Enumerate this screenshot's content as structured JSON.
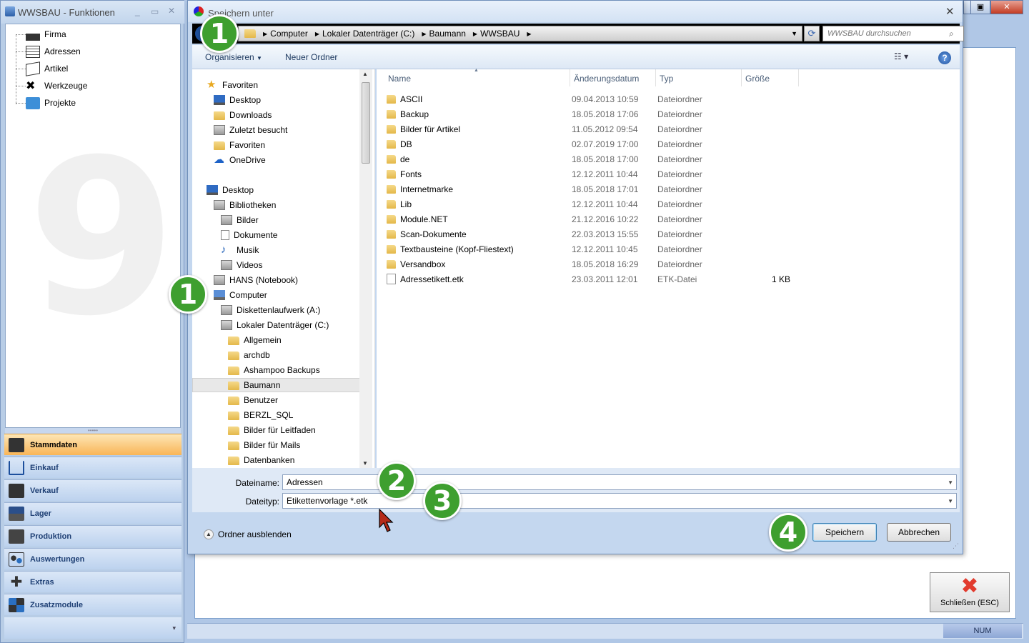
{
  "left_window": {
    "title": "WWSBAU - Funktionen",
    "tree": [
      "Firma",
      "Adressen",
      "Artikel",
      "Werkzeuge",
      "Projekte"
    ],
    "nav": [
      {
        "label": "Stammdaten",
        "active": true
      },
      {
        "label": "Einkauf"
      },
      {
        "label": "Verkauf"
      },
      {
        "label": "Lager"
      },
      {
        "label": "Produktion"
      },
      {
        "label": "Auswertungen"
      },
      {
        "label": "Extras"
      },
      {
        "label": "Zusatzmodule"
      }
    ]
  },
  "dialog": {
    "title": "Speichern unter",
    "breadcrumb": [
      "Computer",
      "Lokaler Datenträger (C:)",
      "Baumann",
      "WWSBAU"
    ],
    "search_placeholder": "WWSBAU durchsuchen",
    "toolbar": {
      "organize": "Organisieren",
      "new_folder": "Neuer Ordner"
    },
    "nav_tree": [
      {
        "label": "Favoriten",
        "level": 0,
        "icon": "star"
      },
      {
        "label": "Desktop",
        "level": 1,
        "icon": "desktop"
      },
      {
        "label": "Downloads",
        "level": 1,
        "icon": "folder"
      },
      {
        "label": "Zuletzt besucht",
        "level": 1,
        "icon": "recent"
      },
      {
        "label": "Favoriten",
        "level": 1,
        "icon": "folder"
      },
      {
        "label": "OneDrive",
        "level": 1,
        "icon": "cloud"
      },
      {
        "label": "Desktop",
        "level": 0,
        "icon": "desktop"
      },
      {
        "label": "Bibliotheken",
        "level": 1,
        "icon": "library"
      },
      {
        "label": "Bilder",
        "level": 2,
        "icon": "pictures"
      },
      {
        "label": "Dokumente",
        "level": 2,
        "icon": "document"
      },
      {
        "label": "Musik",
        "level": 2,
        "icon": "music"
      },
      {
        "label": "Videos",
        "level": 2,
        "icon": "video"
      },
      {
        "label": "HANS (Notebook)",
        "level": 1,
        "icon": "user"
      },
      {
        "label": "Computer",
        "level": 1,
        "icon": "computer"
      },
      {
        "label": "Diskettenlaufwerk (A:)",
        "level": 2,
        "icon": "floppy"
      },
      {
        "label": "Lokaler Datenträger (C:)",
        "level": 2,
        "icon": "drive"
      },
      {
        "label": "Allgemein",
        "level": 3,
        "icon": "folder"
      },
      {
        "label": "archdb",
        "level": 3,
        "icon": "folder"
      },
      {
        "label": "Ashampoo Backups",
        "level": 3,
        "icon": "folder"
      },
      {
        "label": "Baumann",
        "level": 3,
        "icon": "folder",
        "selected": true
      },
      {
        "label": "Benutzer",
        "level": 3,
        "icon": "folder"
      },
      {
        "label": "BERZL_SQL",
        "level": 3,
        "icon": "folder"
      },
      {
        "label": "Bilder für Leitfaden",
        "level": 3,
        "icon": "folder"
      },
      {
        "label": "Bilder für Mails",
        "level": 3,
        "icon": "folder"
      },
      {
        "label": "Datenbanken",
        "level": 3,
        "icon": "folder"
      }
    ],
    "columns": {
      "name": "Name",
      "date": "Änderungsdatum",
      "type": "Typ",
      "size": "Größe"
    },
    "files": [
      {
        "name": "ASCII",
        "date": "09.04.2013 10:59",
        "type": "Dateiordner",
        "size": "",
        "icon": "folder"
      },
      {
        "name": "Backup",
        "date": "18.05.2018 17:06",
        "type": "Dateiordner",
        "size": "",
        "icon": "folder"
      },
      {
        "name": "Bilder für Artikel",
        "date": "11.05.2012 09:54",
        "type": "Dateiordner",
        "size": "",
        "icon": "folder"
      },
      {
        "name": "DB",
        "date": "02.07.2019 17:00",
        "type": "Dateiordner",
        "size": "",
        "icon": "folder"
      },
      {
        "name": "de",
        "date": "18.05.2018 17:00",
        "type": "Dateiordner",
        "size": "",
        "icon": "folder"
      },
      {
        "name": "Fonts",
        "date": "12.12.2011 10:44",
        "type": "Dateiordner",
        "size": "",
        "icon": "folder"
      },
      {
        "name": "Internetmarke",
        "date": "18.05.2018 17:01",
        "type": "Dateiordner",
        "size": "",
        "icon": "folder"
      },
      {
        "name": "Lib",
        "date": "12.12.2011 10:44",
        "type": "Dateiordner",
        "size": "",
        "icon": "folder"
      },
      {
        "name": "Module.NET",
        "date": "21.12.2016 10:22",
        "type": "Dateiordner",
        "size": "",
        "icon": "folder"
      },
      {
        "name": "Scan-Dokumente",
        "date": "22.03.2013 15:55",
        "type": "Dateiordner",
        "size": "",
        "icon": "folder"
      },
      {
        "name": "Textbausteine (Kopf-Fliestext)",
        "date": "12.12.2011 10:45",
        "type": "Dateiordner",
        "size": "",
        "icon": "folder"
      },
      {
        "name": "Versandbox",
        "date": "18.05.2018 16:29",
        "type": "Dateiordner",
        "size": "",
        "icon": "folder"
      },
      {
        "name": "Adressetikett.etk",
        "date": "23.03.2011 12:01",
        "type": "ETK-Datei",
        "size": "1 KB",
        "icon": "file"
      }
    ],
    "filename_label": "Dateiname:",
    "filename_value": "Adressen",
    "filetype_label": "Dateityp:",
    "filetype_value": "Etikettenvorlage *.etk",
    "hide_folders": "Ordner ausblenden",
    "save": "Speichern",
    "cancel": "Abbrechen"
  },
  "close_esc": "Schließen (ESC)",
  "status_num": "NUM",
  "badges": [
    "1",
    "1",
    "2",
    "3",
    "4"
  ]
}
